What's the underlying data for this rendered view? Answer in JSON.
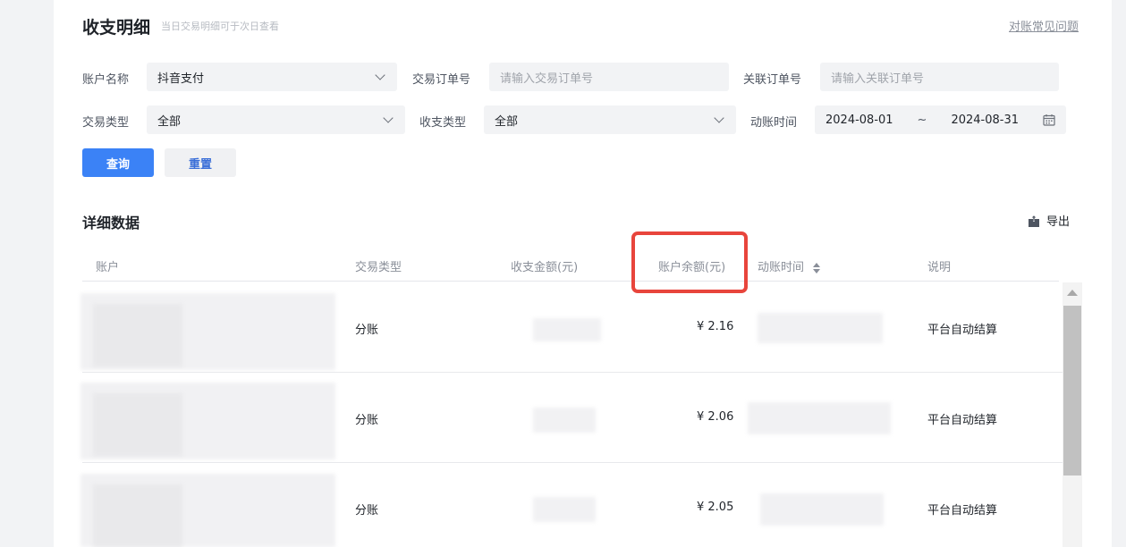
{
  "header": {
    "title": "收支明细",
    "subtitle": "当日交易明细可于次日查看",
    "faq_link": "对账常见问题"
  },
  "filters": {
    "account_name_label": "账户名称",
    "account_name_value": "抖音支付",
    "trade_order_label": "交易订单号",
    "trade_order_placeholder": "请输入交易订单号",
    "related_order_label": "关联订单号",
    "related_order_placeholder": "请输入关联订单号",
    "trade_type_label": "交易类型",
    "trade_type_value": "全部",
    "flow_type_label": "收支类型",
    "flow_type_value": "全部",
    "time_label": "动账时间",
    "date_start": "2024-08-01",
    "date_separator": "~",
    "date_end": "2024-08-31"
  },
  "actions": {
    "query_label": "查询",
    "reset_label": "重置"
  },
  "details": {
    "section_title": "详细数据",
    "export_label": "导出",
    "columns": [
      "账户",
      "交易类型",
      "收支金额(元)",
      "账户余额(元)",
      "动账时间",
      "说明"
    ],
    "rows": [
      {
        "trade_type": "分账",
        "balance": "¥ 2.16",
        "note": "平台自动结算"
      },
      {
        "trade_type": "分账",
        "balance": "¥ 2.06",
        "note": "平台自动结算"
      },
      {
        "trade_type": "分账",
        "balance": "¥ 2.05",
        "note": "平台自动结算"
      }
    ]
  },
  "colors": {
    "primary": "#3b82f6",
    "highlight_box": "#e8453c"
  }
}
